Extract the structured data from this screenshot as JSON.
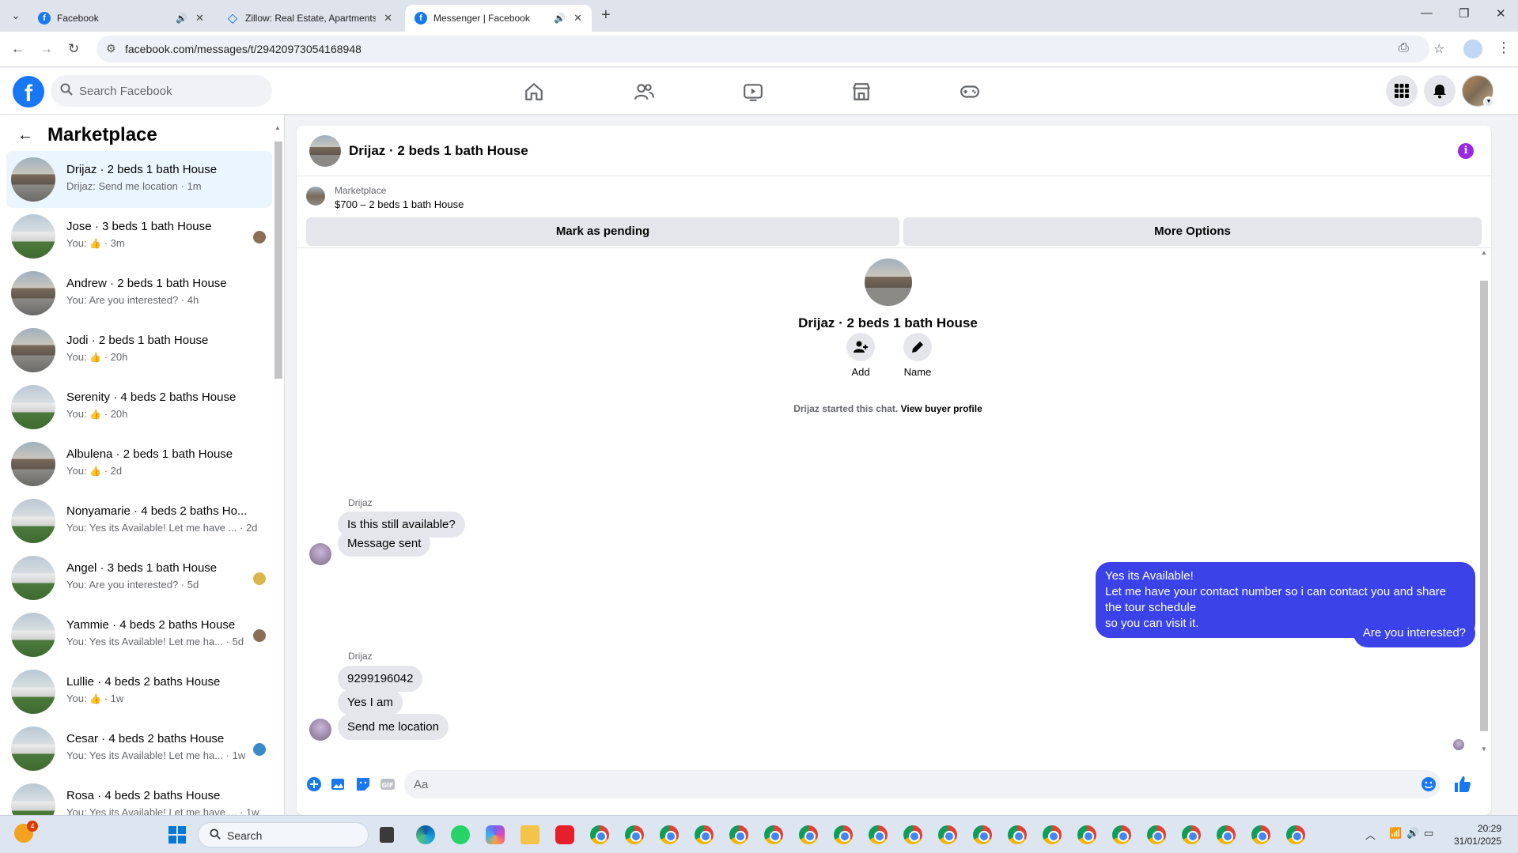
{
  "browser": {
    "tabs": [
      {
        "title": "Facebook",
        "active": false
      },
      {
        "title": "Zillow: Real Estate, Apartments,",
        "active": false
      },
      {
        "title": "Messenger | Facebook",
        "active": true
      }
    ],
    "url": "facebook.com/messages/t/29420973054168948"
  },
  "fb": {
    "logo": "f",
    "search_placeholder": "Search Facebook"
  },
  "sidebar": {
    "title": "Marketplace",
    "conversations": [
      {
        "name": "Drijaz · 2 beds 1 bath House",
        "prefix": "Drijaz: Send me location",
        "like": false,
        "time": " · 1m"
      },
      {
        "name": "Jose · 3 beds 1 bath House",
        "prefix": "You: ",
        "like": true,
        "time": " · 3m"
      },
      {
        "name": "Andrew · 2 beds 1 bath House",
        "prefix": "You: Are you interested?",
        "like": false,
        "time": " · 4h"
      },
      {
        "name": "Jodi · 2 beds 1 bath House",
        "prefix": "You: ",
        "like": true,
        "time": " · 20h"
      },
      {
        "name": "Serenity · 4 beds 2 baths House",
        "prefix": "You: ",
        "like": true,
        "time": " · 20h"
      },
      {
        "name": "Albulena · 2 beds 1 bath House",
        "prefix": "You: ",
        "like": true,
        "time": " · 2d"
      },
      {
        "name": "Nonyamarie · 4 beds 2 baths Ho...",
        "prefix": "You: Yes its Available! Let me have ...",
        "like": false,
        "time": " · 2d"
      },
      {
        "name": "Angel · 3 beds 1 bath House",
        "prefix": "You: Are you interested?",
        "like": false,
        "time": " · 5d"
      },
      {
        "name": "Yammie · 4 beds 2 baths House",
        "prefix": "You: Yes its Available! Let me ha...",
        "like": false,
        "time": " · 5d"
      },
      {
        "name": "Lullie · 4 beds 2 baths House",
        "prefix": "You: ",
        "like": true,
        "time": " · 1w"
      },
      {
        "name": "Cesar · 4 beds 2 baths House",
        "prefix": "You: Yes its Available! Let me ha...",
        "like": false,
        "time": " · 1w"
      },
      {
        "name": "Rosa · 4 beds 2 baths House",
        "prefix": "You: Yes its Available! Let me have ...",
        "like": false,
        "time": " · 1w"
      }
    ]
  },
  "chat": {
    "title": "Drijaz · 2 beds 1 bath House",
    "marketplace_label": "Marketplace",
    "listing": "$700 – 2 beds 1 bath House",
    "mark_pending": "Mark as pending",
    "more_options": "More Options",
    "intro_title": "Drijaz · 2 beds 1 bath House",
    "action_add": "Add",
    "action_name": "Name",
    "started_text": "Drijaz started this chat.",
    "view_profile": "View buyer profile",
    "sender": "Drijaz",
    "msg1": "Is this still available?",
    "msg2": "Message sent",
    "out1": [
      "Yes its Available!",
      "Let me have your contact number so i can contact you and share the tour schedule",
      "so you can visit it."
    ],
    "out2": "Are you interested?",
    "msg3": "9299196042",
    "msg4": "Yes I am",
    "msg5": "Send me location",
    "composer_placeholder": "Aa"
  },
  "taskbar": {
    "weather_badge": "4",
    "search_label": "Search",
    "time": "20:29",
    "date": "31/01/2025"
  },
  "colors": {
    "brand": "#1877f2",
    "outgoing_bubble": "#3a42e8",
    "info": "#9b28e6"
  }
}
